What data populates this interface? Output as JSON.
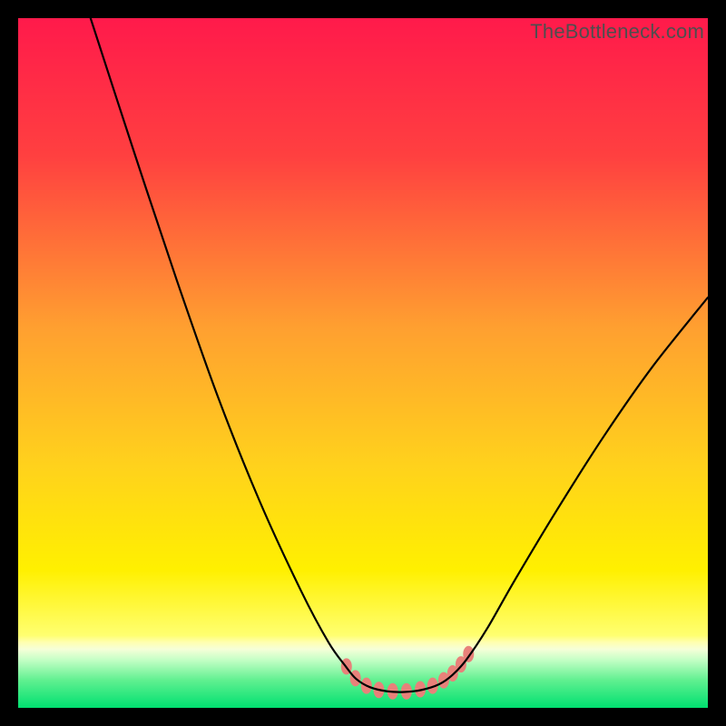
{
  "watermark": "TheBottleneck.com",
  "chart_data": {
    "type": "line",
    "title": "",
    "xlabel": "",
    "ylabel": "",
    "xlim": [
      0,
      100
    ],
    "ylim": [
      0,
      100
    ],
    "gradient_stops": [
      {
        "offset": 0.0,
        "color": "#ff1a4b"
      },
      {
        "offset": 0.2,
        "color": "#ff4040"
      },
      {
        "offset": 0.45,
        "color": "#ffa030"
      },
      {
        "offset": 0.65,
        "color": "#ffd21c"
      },
      {
        "offset": 0.8,
        "color": "#fff000"
      },
      {
        "offset": 0.895,
        "color": "#ffff70"
      },
      {
        "offset": 0.905,
        "color": "#ffffb0"
      },
      {
        "offset": 0.915,
        "color": "#f6ffd8"
      },
      {
        "offset": 0.93,
        "color": "#c6ffc6"
      },
      {
        "offset": 0.96,
        "color": "#60f090"
      },
      {
        "offset": 1.0,
        "color": "#00e070"
      }
    ],
    "series": [
      {
        "name": "curve",
        "stroke": "#000000",
        "stroke_width": 2.2,
        "points": [
          {
            "x": 10.5,
            "y": 100.0
          },
          {
            "x": 17.0,
            "y": 80.0
          },
          {
            "x": 23.0,
            "y": 62.0
          },
          {
            "x": 29.0,
            "y": 45.0
          },
          {
            "x": 35.0,
            "y": 30.0
          },
          {
            "x": 41.0,
            "y": 17.0
          },
          {
            "x": 45.0,
            "y": 9.5
          },
          {
            "x": 47.5,
            "y": 6.0
          },
          {
            "x": 49.0,
            "y": 4.2
          },
          {
            "x": 51.0,
            "y": 3.0
          },
          {
            "x": 53.5,
            "y": 2.4
          },
          {
            "x": 56.0,
            "y": 2.3
          },
          {
            "x": 58.5,
            "y": 2.6
          },
          {
            "x": 61.0,
            "y": 3.4
          },
          {
            "x": 63.0,
            "y": 4.8
          },
          {
            "x": 65.0,
            "y": 7.0
          },
          {
            "x": 68.0,
            "y": 11.5
          },
          {
            "x": 72.0,
            "y": 18.5
          },
          {
            "x": 78.0,
            "y": 28.5
          },
          {
            "x": 85.0,
            "y": 39.5
          },
          {
            "x": 92.0,
            "y": 49.5
          },
          {
            "x": 100.0,
            "y": 59.5
          }
        ]
      }
    ],
    "markers": {
      "fill": "#e8817a",
      "rx": 6,
      "ry": 9,
      "points": [
        {
          "x": 47.6,
          "y": 6.0
        },
        {
          "x": 48.9,
          "y": 4.3
        },
        {
          "x": 50.5,
          "y": 3.2
        },
        {
          "x": 52.3,
          "y": 2.6
        },
        {
          "x": 54.3,
          "y": 2.4
        },
        {
          "x": 56.3,
          "y": 2.4
        },
        {
          "x": 58.3,
          "y": 2.7
        },
        {
          "x": 60.1,
          "y": 3.2
        },
        {
          "x": 61.7,
          "y": 4.0
        },
        {
          "x": 63.0,
          "y": 5.0
        },
        {
          "x": 64.2,
          "y": 6.3
        },
        {
          "x": 65.3,
          "y": 7.8
        }
      ]
    }
  }
}
